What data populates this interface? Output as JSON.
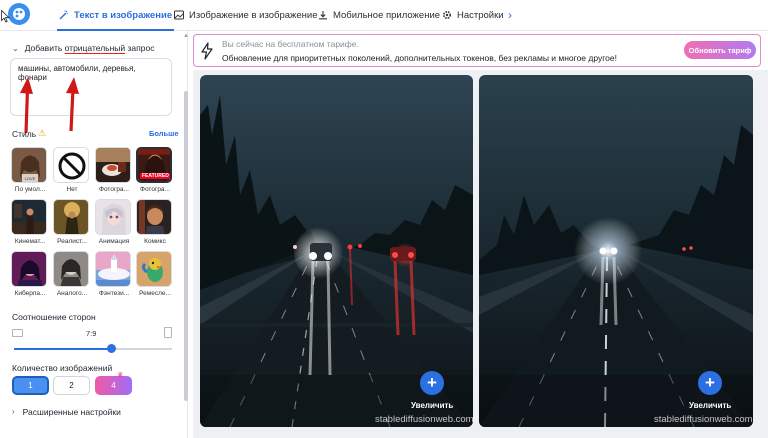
{
  "nav": {
    "tabs": [
      {
        "label": "Текст в изображение",
        "icon": "magic-wand-icon",
        "active": true
      },
      {
        "label": "Изображение в изображение",
        "icon": "image-icon",
        "active": false
      },
      {
        "label": "Мобильное приложение",
        "icon": "download-icon",
        "active": false
      },
      {
        "label": "Настройки",
        "icon": "gear-icon",
        "active": false
      }
    ],
    "more_icon": "chevron-right-icon"
  },
  "sidebar": {
    "negative_prompt": {
      "heading_prefix": "Добавить ",
      "heading_underlined": "отрицательный",
      "heading_suffix": " запрос",
      "value": "машины, автомобили, деревья, фонари"
    },
    "styles": {
      "heading": "Стиль",
      "more_label": "Больше",
      "items": [
        {
          "label": "По умол...",
          "selected": false
        },
        {
          "label": "Нет",
          "selected": false
        },
        {
          "label": "Фотогра...",
          "selected": false
        },
        {
          "label": "Фотогра...",
          "selected": true,
          "badge": "FEATURED"
        },
        {
          "label": "Кинемат...",
          "selected": false
        },
        {
          "label": "Реалист...",
          "selected": false
        },
        {
          "label": "Анимация",
          "selected": false
        },
        {
          "label": "Комикс",
          "selected": false
        },
        {
          "label": "Киберпа...",
          "selected": false
        },
        {
          "label": "Аналого...",
          "selected": false
        },
        {
          "label": "Фэнтези...",
          "selected": false
        },
        {
          "label": "Ремесле...",
          "selected": false
        }
      ]
    },
    "aspect_ratio": {
      "heading": "Соотношение сторон",
      "value": "7:9",
      "slider_fraction": 0.62
    },
    "image_count": {
      "heading": "Количество изображений",
      "options": [
        "1",
        "2",
        "4"
      ],
      "selected": "1"
    },
    "advanced": {
      "label": "Расширенные настройки"
    }
  },
  "promo": {
    "line1": "Вы сейчас на бесплатном тарифе.",
    "line2": "Обновление для приоритетных поколений, дополнительных токенов, без рекламы и многое другое!",
    "button": "Обновить тариф"
  },
  "results": [
    {
      "enlarge_label": "Увеличить",
      "watermark": "stablediffusionweb.com"
    },
    {
      "enlarge_label": "Увеличить",
      "watermark": "stablediffusionweb.com"
    }
  ],
  "colors": {
    "accent": "#2b6fe0",
    "promo_pink": "#ef6fb3",
    "annotation_red": "#d01818"
  }
}
